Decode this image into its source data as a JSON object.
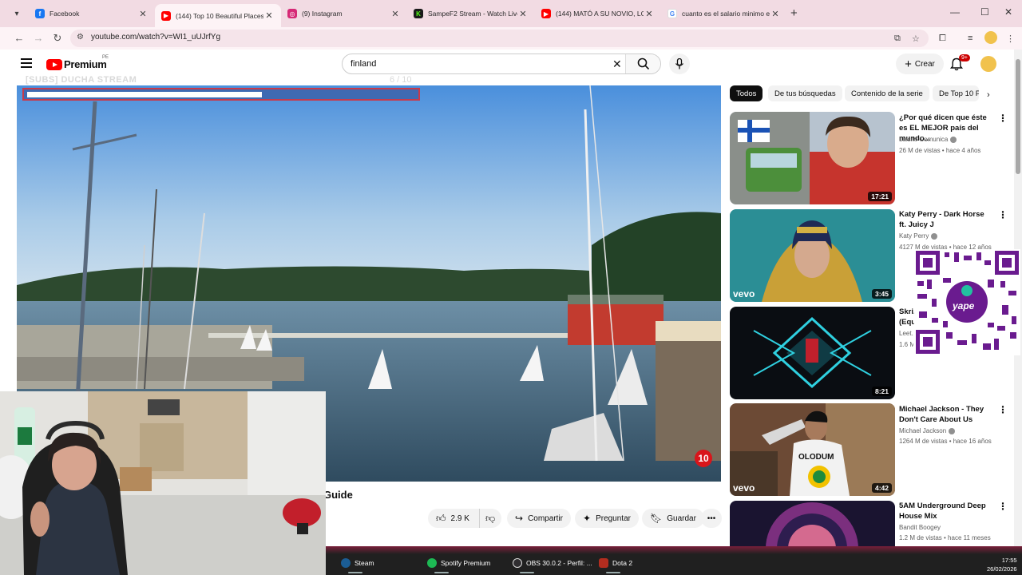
{
  "browser": {
    "tabs": [
      {
        "title": "Facebook",
        "icon": "facebook-icon",
        "color": "#1877f2"
      },
      {
        "title": "(144) Top 10 Beautiful Places to",
        "icon": "youtube-icon",
        "color": "#ff0000",
        "active": true
      },
      {
        "title": "(9) Instagram",
        "icon": "instagram-icon",
        "color": "#d62976"
      },
      {
        "title": "SampeF2 Stream - Watch Live o",
        "icon": "kick-icon",
        "color": "#53fc18"
      },
      {
        "title": "(144) MATÓ A SU NOVIO, LO CC",
        "icon": "youtube-icon",
        "color": "#ff0000"
      },
      {
        "title": "cuanto es el salario minimo en",
        "icon": "google-icon",
        "color": "#4285f4"
      }
    ],
    "url": "youtube.com/watch?v=WI1_uUJrfYg"
  },
  "youtube": {
    "brand": "Premium",
    "region": "PE",
    "search_value": "finland",
    "create_label": "Crear",
    "notifications": "9+"
  },
  "overlay": {
    "ghost_title": "[SUBS] DUCHA STREAM",
    "ghost_count": "6 / 10",
    "goal_progress": 0.6,
    "channel_badge": "10"
  },
  "video": {
    "title_fragment": "Guide",
    "likes": "2.9 K",
    "share_label": "Compartir",
    "ask_label": "Preguntar",
    "save_label": "Guardar"
  },
  "chips": [
    "Todos",
    "De tus búsquedas",
    "Contenido de la serie",
    "De Top 10 P"
  ],
  "recommendations": [
    {
      "title": "¿Por qué dicen que éste es EL MEJOR país del mundo...",
      "channel": "Luisito Comunica",
      "verified": true,
      "meta": "26 M de vistas • hace 4 años",
      "duration": "17:21"
    },
    {
      "title": "Katy Perry - Dark Horse ft. Juicy J",
      "channel": "Katy Perry",
      "verified": true,
      "meta": "4127 M de vistas • hace 12 años",
      "duration": "3:45"
    },
    {
      "title": "Skri... (Equ...",
      "channel": "Leet...",
      "verified": false,
      "meta": "1.6 M...",
      "duration": "8:21"
    },
    {
      "title": "Michael Jackson - They Don't Care About Us",
      "channel": "Michael Jackson",
      "verified": true,
      "meta": "1264 M de vistas • hace 16 años",
      "duration": "4:42"
    },
    {
      "title": "5AM Underground Deep House Mix",
      "channel": "Bandit Boogey",
      "verified": false,
      "meta": "1.2 M de vistas • hace 11 meses",
      "duration": ""
    }
  ],
  "qr_brand": "yape",
  "taskbar": {
    "apps": [
      "Steam",
      "Spotify Premium",
      "OBS 30.0.2 - Perfil: ...",
      "Dota 2"
    ],
    "time": "17:55",
    "date": "26/02/2026"
  },
  "colors": {
    "tabstrip": "#f2dbe3",
    "youtube_red": "#ff0000",
    "goal_border": "#c8394a",
    "goal_fill": "#3f6ab2"
  }
}
